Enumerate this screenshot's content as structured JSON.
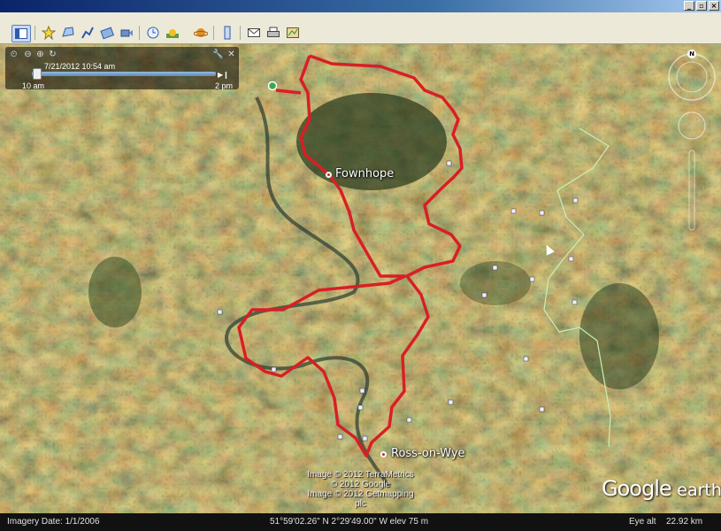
{
  "window": {
    "controls": {
      "minimize": "_",
      "restore": "▫",
      "close": "×"
    }
  },
  "toolbar": {
    "buttons": [
      {
        "name": "sidebar-toggle-button",
        "icon": "sidebar-icon"
      },
      {
        "name": "add-placemark-button",
        "icon": "placemark-icon"
      },
      {
        "name": "add-polygon-button",
        "icon": "polygon-icon"
      },
      {
        "name": "add-path-button",
        "icon": "path-icon"
      },
      {
        "name": "add-image-overlay-button",
        "icon": "image-overlay-icon"
      },
      {
        "name": "record-tour-button",
        "icon": "tour-icon"
      },
      {
        "name": "historical-imagery-button",
        "icon": "clock-icon"
      },
      {
        "name": "sunlight-button",
        "icon": "sun-icon"
      },
      {
        "name": "switch-planet-button",
        "icon": "planet-icon"
      },
      {
        "name": "ruler-button",
        "icon": "ruler-icon"
      },
      {
        "name": "email-button",
        "icon": "email-icon"
      },
      {
        "name": "print-button",
        "icon": "print-icon"
      },
      {
        "name": "view-in-maps-button",
        "icon": "maps-icon"
      }
    ]
  },
  "time_slider": {
    "current_time": "7/21/2012  10:54 am",
    "start_label": "10 am",
    "end_label": "2 pm",
    "position": 0.03,
    "icons": [
      "clock-icon",
      "zoom-out-icon",
      "zoom-in-icon",
      "zoom-reset-icon",
      "wrench-icon",
      "close-icon"
    ]
  },
  "places": {
    "fownhope": "Fownhope",
    "ross": "Ross-on-Wye"
  },
  "credits": {
    "line1": "Image © 2012 TerraMetrics",
    "line2": "© 2012 Google",
    "line3": "Image © 2012 Getmapping plc"
  },
  "brand": {
    "google": "Google",
    "earth": "earth"
  },
  "status": {
    "imagery_date": "Imagery Date: 1/1/2006",
    "coordinates": "51°59'02.26\" N   2°29'49.00\" W  elev   75 m",
    "eye_alt_label": "Eye alt",
    "eye_alt_value": "22.92 km"
  },
  "colors": {
    "track": "#d81f26",
    "boundary": "#c8f0b4",
    "status_bg": "#111111"
  }
}
